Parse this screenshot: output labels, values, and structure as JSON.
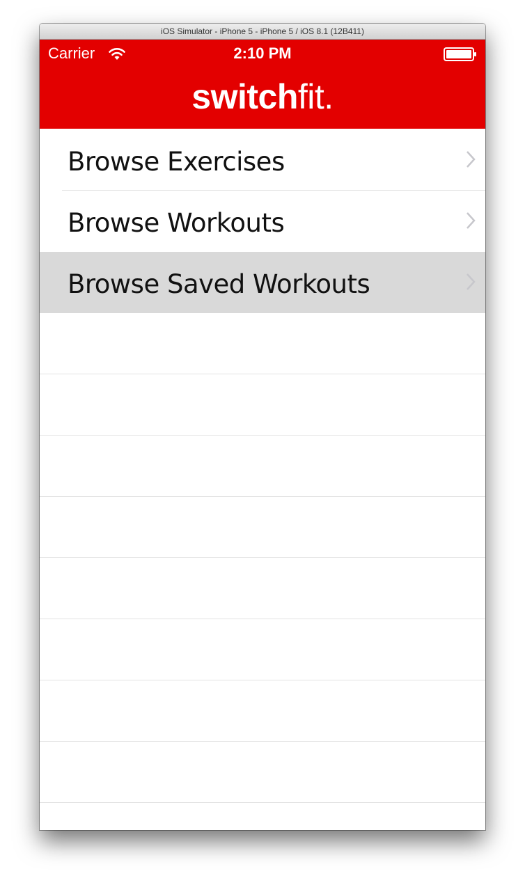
{
  "window": {
    "title": "iOS Simulator - iPhone 5 - iPhone 5 / iOS 8.1 (12B411)"
  },
  "status_bar": {
    "carrier": "Carrier",
    "time": "2:10 PM",
    "icons": [
      "wifi-icon",
      "battery-icon"
    ]
  },
  "nav": {
    "logo_bold": "switch",
    "logo_light": "fit."
  },
  "menu": {
    "items": [
      {
        "label": "Browse Exercises",
        "selected": false
      },
      {
        "label": "Browse Workouts",
        "selected": false
      },
      {
        "label": "Browse Saved Workouts",
        "selected": true
      }
    ]
  },
  "colors": {
    "brand_red": "#e30000",
    "selected_row": "#d9d9d9",
    "chevron": "#c7c7cc"
  }
}
